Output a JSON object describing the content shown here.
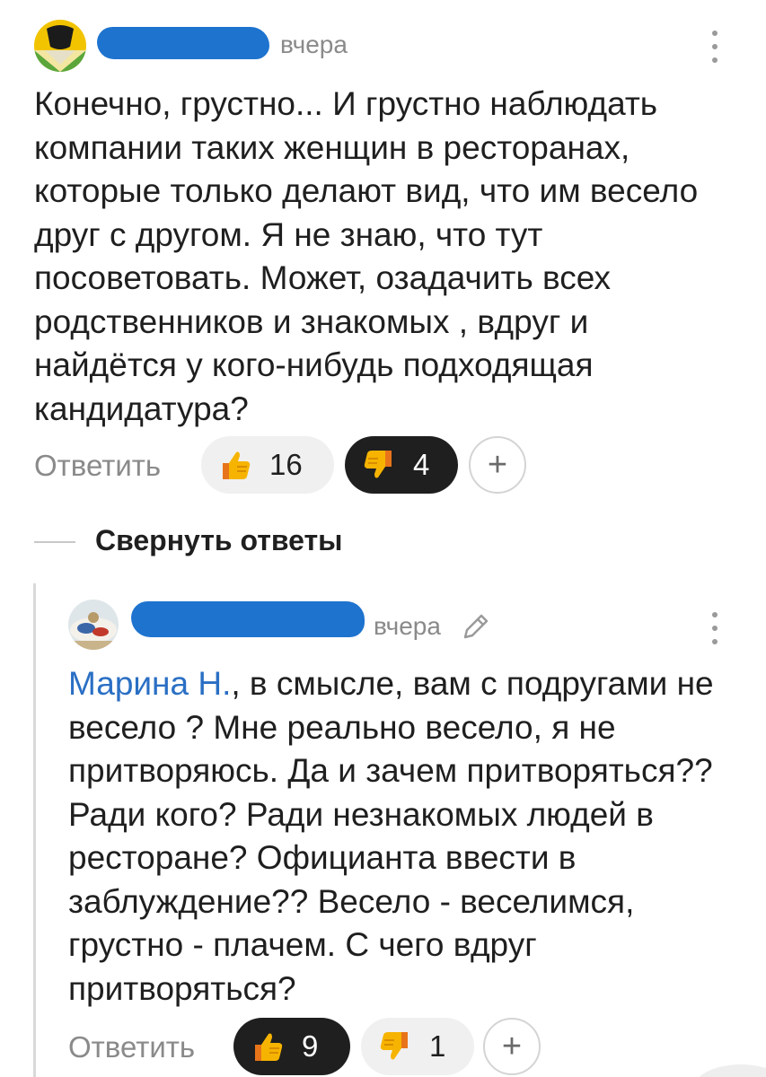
{
  "top_comment": {
    "time": "вчера",
    "text": "Конечно, грустно... И грустно наблюдать компании таких женщин в ресторанах, которые только делают вид, что им весело друг с другом. Я не знаю, что тут посоветовать. Может, озадачить всех родственников и знакомых , вдруг и найдётся у кого-нибудь подходящая кандидатура?",
    "reply_label": "Ответить",
    "likes": "16",
    "dislikes": "4",
    "add_reaction": "+",
    "like_icon": "thumbs-up-icon",
    "dislike_icon": "thumbs-down-icon"
  },
  "collapse_replies_label": "Свернуть ответы",
  "reply_comment": {
    "time": "вчера",
    "mention": "Марина Н.",
    "text": ", в смысле, вам с подругами не весело ? Мне реально весело, я не притворяюсь. Да и зачем притворяться?? Ради кого? Ради незнакомых людей в ресторане? Официанта ввести в заблуждение?? Весело - веселимся, грустно - плачем. С чего вдруг притворяться?",
    "reply_label": "Ответить",
    "likes": "9",
    "dislikes": "1",
    "add_reaction": "+"
  },
  "colors": {
    "mention": "#2a6fc4",
    "redaction": "#1e73cf",
    "dark_pill": "#1f1f1f",
    "light_pill": "#f0f0f0",
    "muted_text": "#8a8a8a"
  }
}
